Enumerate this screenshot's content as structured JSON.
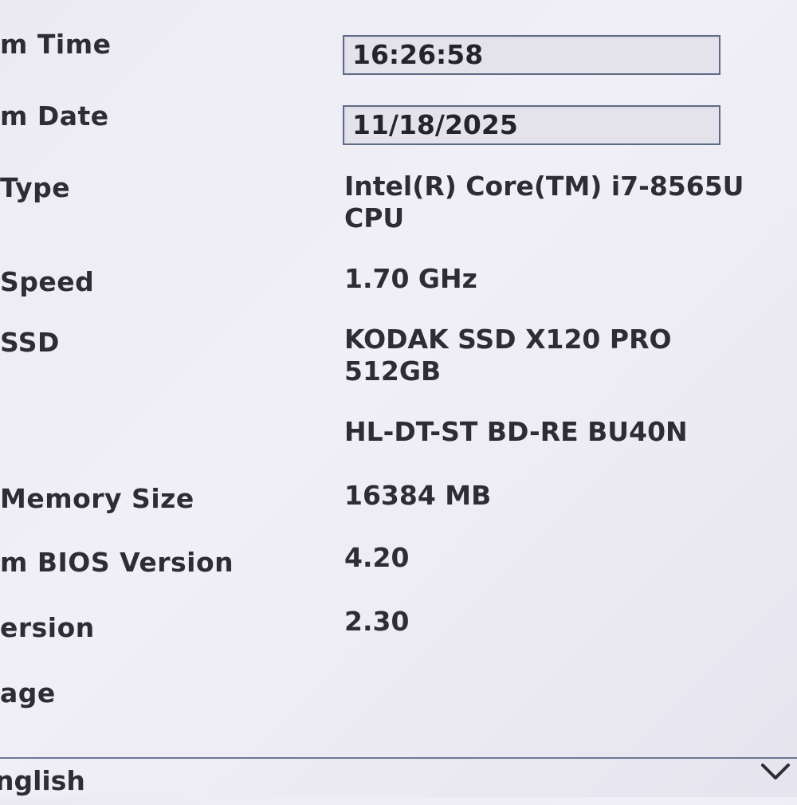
{
  "rows": {
    "time": {
      "label": "m Time",
      "value": "16:26:58"
    },
    "date": {
      "label": "m Date",
      "value": "11/18/2025"
    },
    "type": {
      "label": "Type",
      "value": "Intel(R) Core(TM) i7-8565U\nCPU"
    },
    "speed": {
      "label": "Speed",
      "value": "1.70 GHz"
    },
    "ssd": {
      "label": "SSD",
      "value": "KODAK SSD X120 PRO\n512GB"
    },
    "optical": {
      "label": "",
      "value": "HL-DT-ST BD-RE BU40N"
    },
    "memory": {
      "label": "Memory Size",
      "value": "16384 MB"
    },
    "bios": {
      "label": "m BIOS Version",
      "value": "4.20"
    },
    "version": {
      "label": "ersion",
      "value": "2.30"
    },
    "language": {
      "label": "age",
      "value": "nglish"
    }
  },
  "icons": {
    "dropdown": "chevron-down-icon"
  },
  "colors": {
    "field_border": "#5f6b86",
    "background": "#eceaf3",
    "text": "#2c2d35"
  }
}
